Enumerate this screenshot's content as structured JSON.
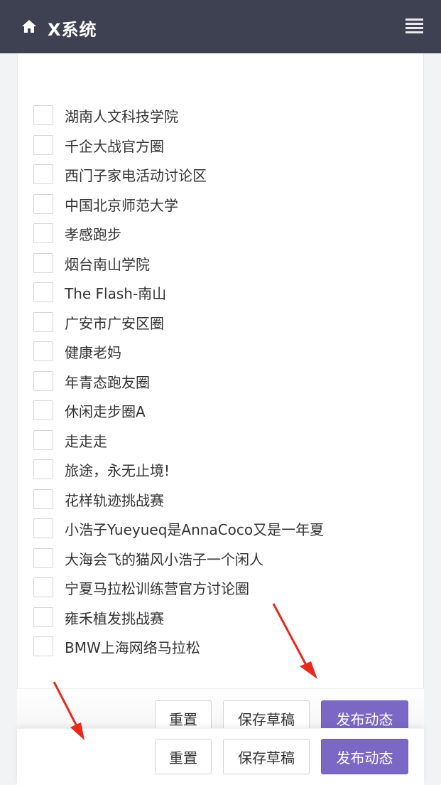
{
  "header": {
    "title": "X系统",
    "home_icon": "home-icon",
    "menu_icon": "hamburger-menu-icon",
    "background_color": "#3d4152"
  },
  "groups": [
    {
      "label": "湖南人文科技学院",
      "checked": false
    },
    {
      "label": "千企大战官方圈",
      "checked": false
    },
    {
      "label": "西门子家电活动讨论区",
      "checked": false
    },
    {
      "label": "中国北京师范大学",
      "checked": false
    },
    {
      "label": "孝感跑步",
      "checked": false
    },
    {
      "label": "烟台南山学院",
      "checked": false
    },
    {
      "label": "The Flash-南山",
      "checked": false
    },
    {
      "label": "广安市广安区圈",
      "checked": false
    },
    {
      "label": "健康老妈",
      "checked": false
    },
    {
      "label": "年青态跑友圈",
      "checked": false
    },
    {
      "label": "休闲走步圈A",
      "checked": false
    },
    {
      "label": "走走走",
      "checked": false
    },
    {
      "label": "旅途，永无止境!",
      "checked": false
    },
    {
      "label": "花样轨迹挑战赛",
      "checked": false
    },
    {
      "label": "小浩子Yueyueq是AnnaCoco又是一年夏",
      "checked": false
    },
    {
      "label": "大海会飞的猫风小浩子一个闲人",
      "checked": false
    },
    {
      "label": "宁夏马拉松训练营官方讨论圈",
      "checked": false
    },
    {
      "label": "雍禾植发挑战赛",
      "checked": false
    },
    {
      "label": "BMW上海网络马拉松",
      "checked": false
    }
  ],
  "actions": {
    "reset_label": "重置",
    "save_draft_label": "保存草稿",
    "publish_label": "发布动态",
    "primary_color": "#7b68c4"
  },
  "annotation_color": "#e8291c"
}
